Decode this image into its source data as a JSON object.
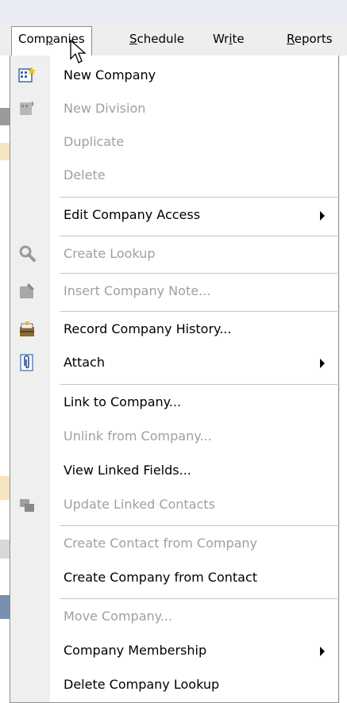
{
  "menubar": {
    "items": [
      {
        "label": "Companies",
        "accel": "p"
      },
      {
        "label": "Schedule",
        "accel": "S"
      },
      {
        "label": "Write",
        "accel": "i"
      },
      {
        "label": "Reports",
        "accel": "R"
      }
    ]
  },
  "menu": {
    "items": [
      {
        "label": "New Company",
        "disabled": false,
        "icon": "new-company-icon"
      },
      {
        "label": "New Division",
        "disabled": true,
        "icon": "new-division-icon"
      },
      {
        "label": "Duplicate",
        "disabled": true
      },
      {
        "label": "Delete",
        "disabled": true
      },
      {
        "label": "Edit Company Access",
        "disabled": false,
        "submenu": true
      },
      {
        "label": "Create Lookup",
        "disabled": true,
        "icon": "lookup-magnifier-icon"
      },
      {
        "label": "Insert Company Note...",
        "disabled": true,
        "icon": "note-icon"
      },
      {
        "label": "Record Company History...",
        "disabled": false,
        "icon": "history-icon"
      },
      {
        "label": "Attach",
        "disabled": false,
        "submenu": true,
        "icon": "paperclip-icon"
      },
      {
        "label": "Link to Company...",
        "disabled": false
      },
      {
        "label": "Unlink from Company...",
        "disabled": true
      },
      {
        "label": "View Linked Fields...",
        "disabled": false
      },
      {
        "label": "Update Linked Contacts",
        "disabled": true,
        "icon": "update-contacts-icon"
      },
      {
        "label": "Create Contact from Company",
        "disabled": true
      },
      {
        "label": "Create Company from Contact",
        "disabled": false
      },
      {
        "label": "Move Company...",
        "disabled": true
      },
      {
        "label": "Company Membership",
        "disabled": false,
        "submenu": true
      },
      {
        "label": "Delete Company Lookup",
        "disabled": false
      }
    ]
  },
  "colors": {
    "menu_bg": "#ffffff",
    "gutter_bg": "#efefef",
    "disabled_text": "#a0a0a0",
    "separator": "#c5c5c5",
    "border": "#8e8e8e"
  }
}
